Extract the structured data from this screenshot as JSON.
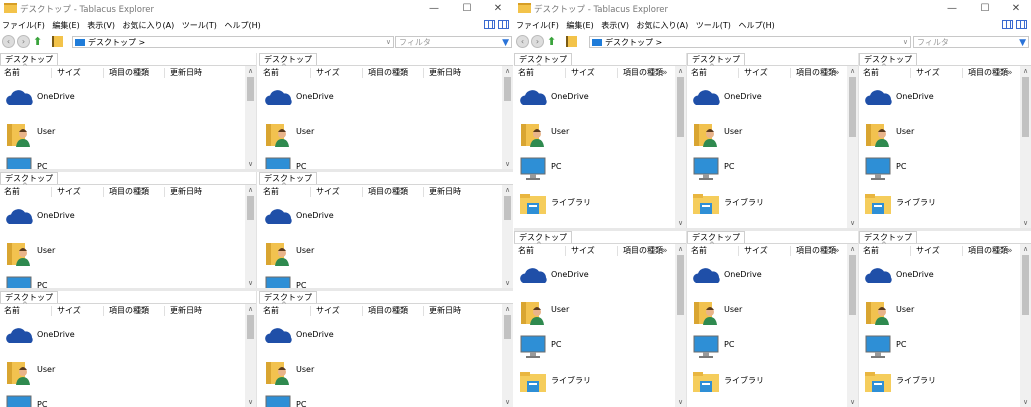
{
  "window_title": "デスクトップ - Tablacus Explorer",
  "window_controls": [
    "—",
    "☐",
    "✕"
  ],
  "menu": [
    "ファイル(F)",
    "編集(E)",
    "表示(V)",
    "お気に入り(A)",
    "ツール(T)",
    "ヘルプ(H)"
  ],
  "address": {
    "value": "デスクトップ >",
    "dropdown": "∨"
  },
  "filter": {
    "placeholder": "フィルタ"
  },
  "nav": {
    "back": "‹",
    "forward": "›",
    "up": "⬆"
  },
  "tab_label": "デスクトップ",
  "columns": [
    "名前",
    "サイズ",
    "項目の種類",
    "更新日時"
  ],
  "more_columns": "»",
  "scroll": {
    "up": "∧",
    "down": "∨"
  },
  "items": [
    {
      "label": "OneDrive",
      "icon": "onedrive-cloud-icon"
    },
    {
      "label": "User",
      "icon": "user-folder-icon"
    },
    {
      "label": "PC",
      "icon": "pc-monitor-icon"
    },
    {
      "label": "ライブラリ",
      "icon": "library-folder-icon"
    }
  ]
}
